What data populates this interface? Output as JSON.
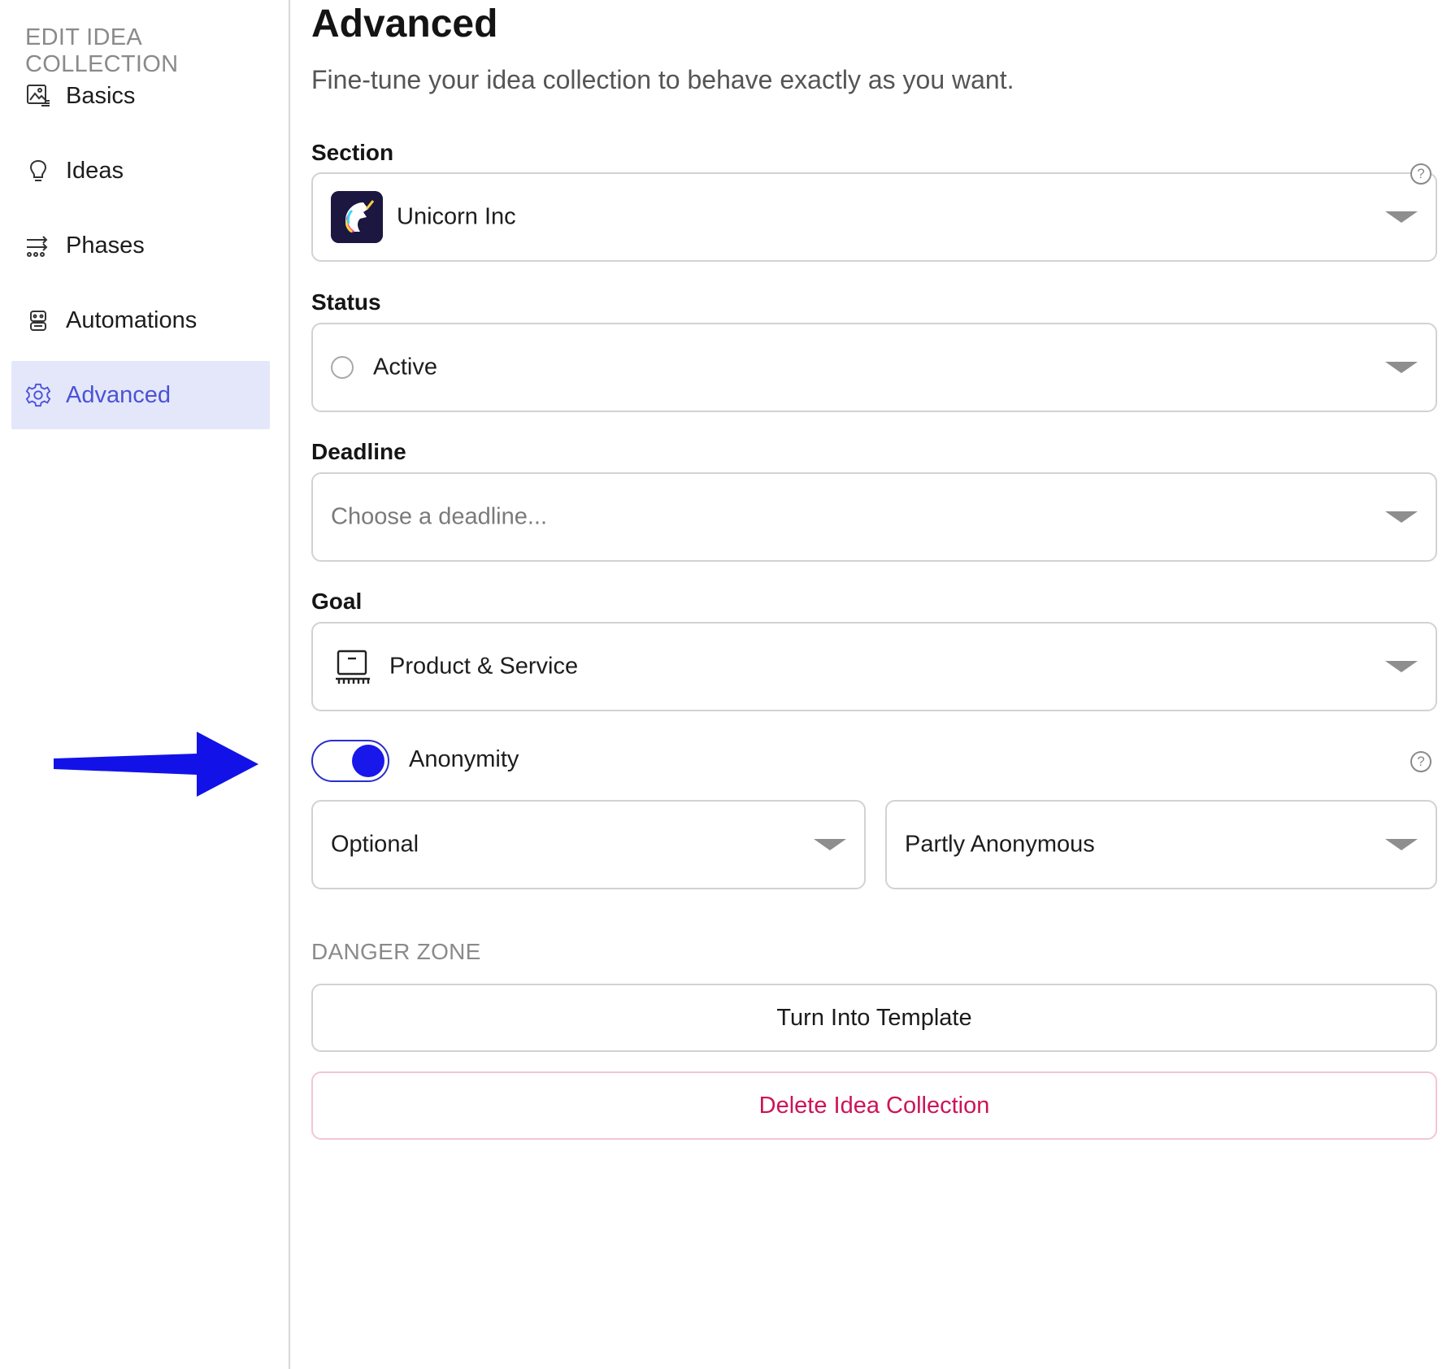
{
  "sidebar": {
    "heading": "EDIT IDEA COLLECTION",
    "items": [
      {
        "label": "Basics",
        "icon": "image-text-icon",
        "active": false
      },
      {
        "label": "Ideas",
        "icon": "lightbulb-icon",
        "active": false
      },
      {
        "label": "Phases",
        "icon": "phases-icon",
        "active": false
      },
      {
        "label": "Automations",
        "icon": "robot-icon",
        "active": false
      },
      {
        "label": "Advanced",
        "icon": "gear-icon",
        "active": true
      }
    ]
  },
  "main": {
    "title": "Advanced",
    "subtitle": "Fine-tune your idea collection to behave exactly as you want.",
    "section": {
      "label": "Section",
      "value": "Unicorn Inc",
      "icon": "unicorn-logo"
    },
    "status": {
      "label": "Status",
      "value": "Active"
    },
    "deadline": {
      "label": "Deadline",
      "placeholder": "Choose a deadline..."
    },
    "goal": {
      "label": "Goal",
      "value": "Product & Service",
      "icon": "product-service-icon"
    },
    "anonymity": {
      "label": "Anonymity",
      "enabled": true,
      "mode": "Optional",
      "level": "Partly Anonymous"
    },
    "danger_zone": {
      "heading": "DANGER ZONE",
      "template_button": "Turn Into Template",
      "delete_button": "Delete Idea Collection"
    }
  },
  "colors": {
    "accent": "#4a52d8",
    "toggle": "#1818ea",
    "arrow": "#1212e8",
    "active_bg": "#e4e7fa",
    "danger": "#cc1457"
  }
}
